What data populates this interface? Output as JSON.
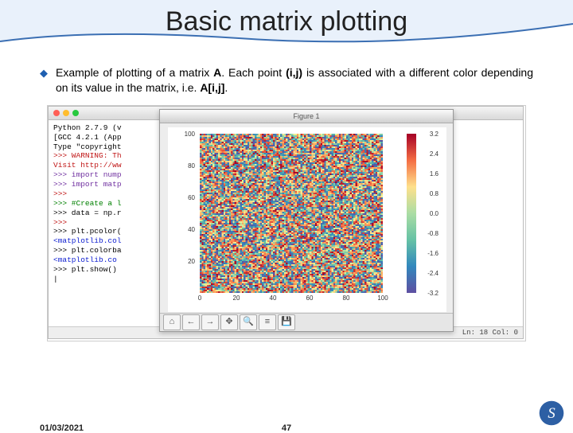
{
  "title": "Basic matrix plotting",
  "bullet": {
    "text_pre": "Example of plotting of a matrix ",
    "emA": "A",
    "text_mid1": ". Each point ",
    "emIJ": "(i,j)",
    "text_mid2": " is associated with a different color depending on its value in the matrix, i.e. ",
    "emAij": "A[i,j]",
    "text_end": "."
  },
  "terminal": {
    "lines": [
      {
        "cls": "",
        "t": "Python 2.7.9 (v"
      },
      {
        "cls": "",
        "t": "[GCC 4.2.1 (App"
      },
      {
        "cls": "",
        "t": "Type \"copyright"
      },
      {
        "cls": "red",
        "t": ">>> WARNING: Th"
      },
      {
        "cls": "red",
        "t": "Visit http://ww"
      },
      {
        "cls": "",
        "t": ""
      },
      {
        "cls": "purple",
        "t": ">>> import nump"
      },
      {
        "cls": "purple",
        "t": ">>> import matp"
      },
      {
        "cls": "red",
        "t": ">>> "
      },
      {
        "cls": "green",
        "t": ">>> #Create a l"
      },
      {
        "cls": "",
        "t": ">>> data = np.r"
      },
      {
        "cls": "red",
        "t": ">>> "
      },
      {
        "cls": "",
        "t": ">>> plt.pcolor("
      },
      {
        "cls": "blue",
        "t": "<matplotlib.col"
      },
      {
        "cls": "",
        "t": ">>> plt.colorba"
      },
      {
        "cls": "blue",
        "t": "<matplotlib.co"
      },
      {
        "cls": "",
        "t": ">>> plt.show()"
      },
      {
        "cls": "",
        "t": "|"
      }
    ],
    "status": "Ln: 18 Col: 0"
  },
  "figure": {
    "title": "Figure 1",
    "yticks": [
      "100",
      "80",
      "60",
      "40",
      "20"
    ],
    "xticks": [
      "0",
      "20",
      "40",
      "60",
      "80",
      "100"
    ],
    "colorbar_ticks": [
      "3.2",
      "2.4",
      "1.6",
      "0.8",
      "0.0",
      "-0.8",
      "-1.6",
      "-2.4",
      "-3.2"
    ],
    "toolbar_icons": [
      "home-icon",
      "back-icon",
      "forward-icon",
      "pan-icon",
      "zoom-icon",
      "config-icon",
      "save-icon"
    ],
    "toolbar_glyphs": [
      "⌂",
      "←",
      "→",
      "✥",
      "🔍",
      "≡",
      "💾"
    ]
  },
  "chart_data": {
    "type": "heatmap",
    "title": "",
    "xlabel": "",
    "ylabel": "",
    "xlim": [
      0,
      100
    ],
    "ylim": [
      0,
      100
    ],
    "xticks": [
      0,
      20,
      40,
      60,
      80,
      100
    ],
    "yticks": [
      20,
      40,
      60,
      80,
      100
    ],
    "colorbar": {
      "vmin": -3.2,
      "vmax": 3.2,
      "ticks": [
        3.2,
        2.4,
        1.6,
        0.8,
        0.0,
        -0.8,
        -1.6,
        -2.4,
        -3.2
      ]
    },
    "description": "100x100 matrix of standard-normal random values rendered with plt.pcolor and a diverging colormap"
  },
  "footer": {
    "date": "01/03/2021",
    "page": "47"
  }
}
